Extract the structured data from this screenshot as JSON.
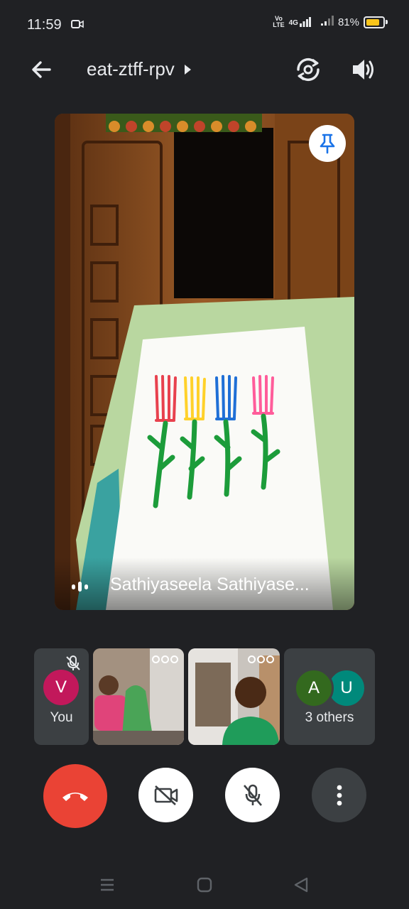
{
  "status": {
    "time": "11:59",
    "volte_top": "Vo",
    "volte_bottom": "LTE",
    "network": "4G",
    "battery": "81%",
    "battery_level": 0.81
  },
  "header": {
    "meeting_code": "eat-ztff-rpv"
  },
  "main_tile": {
    "participant_name": "Sathiyaseela Sathiyase..."
  },
  "participants": {
    "self_initial": "V",
    "self_label": "You",
    "others_initials": [
      "A",
      "U"
    ],
    "others_label": "3 others"
  },
  "colors": {
    "end_call": "#ea4335",
    "self_avatar": "#c2185b",
    "avatar_a": "#33691e",
    "avatar_u": "#00897b",
    "pin_blue": "#1a73e8",
    "battery_fill": "#f9c51b"
  },
  "icons": {
    "back": "arrow-left-icon",
    "switch_camera": "switch-camera-icon",
    "speaker": "speaker-icon",
    "pin": "pin-icon",
    "end_call": "phone-hangup-icon",
    "camera": "video-off-icon",
    "mic": "mic-off-icon",
    "more": "more-vert-icon"
  }
}
